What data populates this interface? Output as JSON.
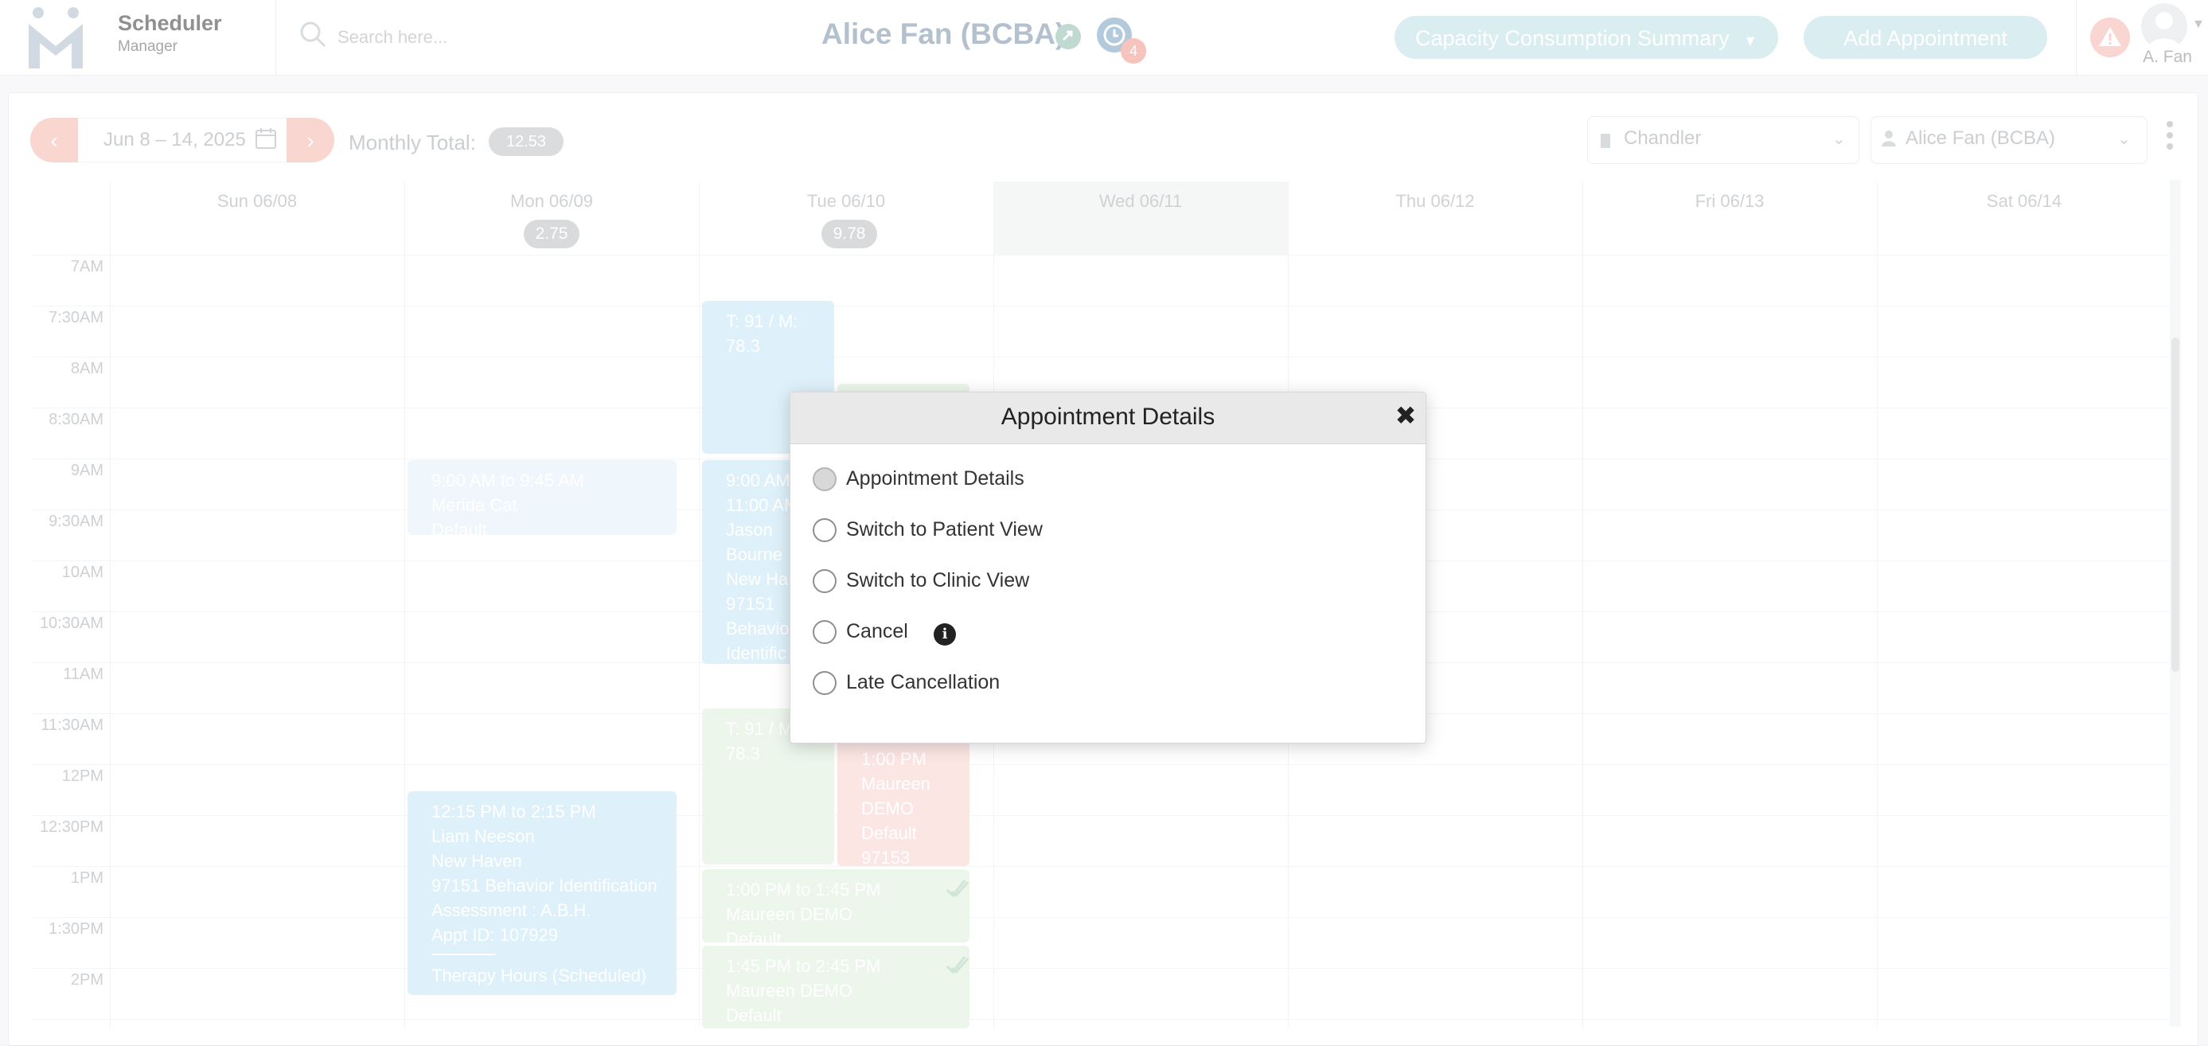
{
  "header": {
    "app_name": "Scheduler",
    "app_role": "Manager",
    "search_placeholder": "Search here...",
    "provider_name": "Alice Fan (BCBA)",
    "notification_badge": "4",
    "capacity_button": "Capacity Consumption Summary",
    "add_button": "Add Appointment",
    "user_name": "A. Fan"
  },
  "toolbar": {
    "date_range": "Jun 8 – 14, 2025",
    "monthly_label": "Monthly Total:",
    "monthly_value": "12.53",
    "location": "Chandler",
    "provider_filter": "Alice Fan (BCBA)"
  },
  "days": [
    {
      "label": "Sun 06/08",
      "total": ""
    },
    {
      "label": "Mon 06/09",
      "total": "2.75"
    },
    {
      "label": "Tue 06/10",
      "total": "9.78"
    },
    {
      "label": "Wed 06/11",
      "total": ""
    },
    {
      "label": "Thu 06/12",
      "total": ""
    },
    {
      "label": "Fri 06/13",
      "total": ""
    },
    {
      "label": "Sat 06/14",
      "total": ""
    }
  ],
  "times": [
    "7AM",
    "7:30AM",
    "8AM",
    "8:30AM",
    "9AM",
    "9:30AM",
    "10AM",
    "10:30AM",
    "11AM",
    "11:30AM",
    "12PM",
    "12:30PM",
    "1PM",
    "1:30PM",
    "2PM"
  ],
  "appointments": {
    "tue_a": [
      "T: 91 / M:",
      "78.3"
    ],
    "mon_a": [
      "9:00 AM to 9:45 AM",
      "Merida Cat",
      "Default"
    ],
    "tue_b": [
      "9:00 AM",
      "11:00 AM",
      "Jason",
      "Bourne",
      "New Ha",
      "97151",
      "Behavio",
      "Identific"
    ],
    "tue_c": [
      "T: 91 / M:",
      "78.3"
    ],
    "tue_d": [
      "1:00 PM",
      "Maureen",
      "DEMO",
      "Default",
      "97153"
    ],
    "mon_b": [
      "12:15 PM to 2:15 PM",
      "Liam Neeson",
      "New Haven",
      "97151 Behavior Identification",
      "Assessment : A.B.H.",
      "Appt ID: 107929",
      "Therapy Hours (Scheduled)"
    ],
    "tue_e": [
      "1:00 PM to 1:45 PM",
      "Maureen DEMO",
      "Default"
    ],
    "tue_f": [
      "1:45 PM to 2:45 PM",
      "Maureen DEMO",
      "Default"
    ]
  },
  "dialog": {
    "title": "Appointment Details",
    "options": [
      "Appointment Details",
      "Switch to Patient View",
      "Switch to Clinic View",
      "Cancel",
      "Late Cancellation"
    ],
    "selected": "Appointment Details"
  },
  "colors": {
    "brand": "#8b9eb4",
    "accent_pill": "#c7e3ea",
    "nav_arrow": "#f7c0b7",
    "appt_blue": "#cde8f6",
    "appt_green": "#e2f1e1",
    "appt_red": "#fbd9d5"
  }
}
